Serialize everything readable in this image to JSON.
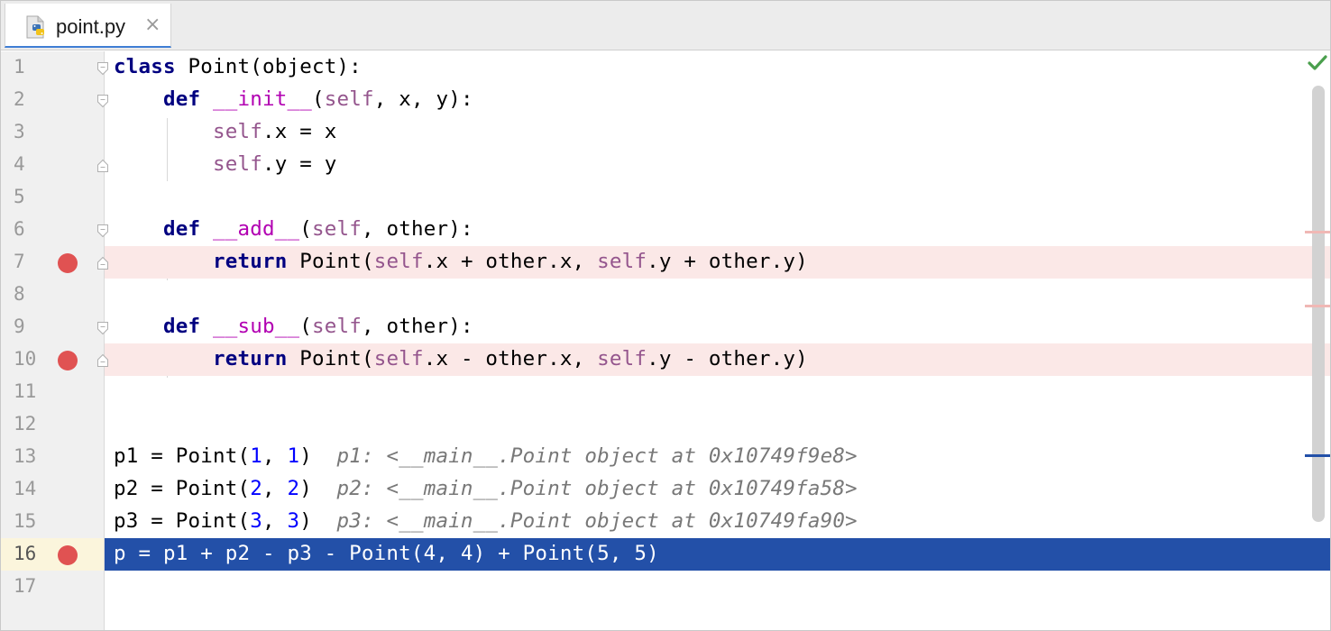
{
  "tab": {
    "filename": "point.py",
    "close": "×"
  },
  "colors": {
    "breakpoint": "#e05252",
    "breakpoint_line": "#fbe8e7",
    "execution_line": "#2350a8",
    "keyword": "#000080",
    "self": "#94558d",
    "dunder": "#b200b2",
    "number": "#0000ff",
    "inline_value": "#787878"
  },
  "status": {
    "inspection": "check-icon"
  },
  "lines": [
    {
      "n": "1",
      "breakpoint": false,
      "current": false,
      "fold": "open",
      "code": [
        {
          "t": "class",
          "c": "kw"
        },
        {
          "t": " Point(object):"
        }
      ]
    },
    {
      "n": "2",
      "breakpoint": false,
      "current": false,
      "fold": "open",
      "code": [
        {
          "t": "    "
        },
        {
          "t": "def",
          "c": "kw"
        },
        {
          "t": " "
        },
        {
          "t": "__init__",
          "c": "dunder"
        },
        {
          "t": "("
        },
        {
          "t": "self",
          "c": "self"
        },
        {
          "t": ", x, y):"
        }
      ]
    },
    {
      "n": "3",
      "breakpoint": false,
      "current": false,
      "fold": "",
      "code": [
        {
          "t": "        "
        },
        {
          "t": "self",
          "c": "self"
        },
        {
          "t": ".x = x"
        }
      ]
    },
    {
      "n": "4",
      "breakpoint": false,
      "current": false,
      "fold": "close",
      "code": [
        {
          "t": "        "
        },
        {
          "t": "self",
          "c": "self"
        },
        {
          "t": ".y = y"
        }
      ]
    },
    {
      "n": "5",
      "breakpoint": false,
      "current": false,
      "fold": "",
      "code": []
    },
    {
      "n": "6",
      "breakpoint": false,
      "current": false,
      "fold": "open",
      "code": [
        {
          "t": "    "
        },
        {
          "t": "def",
          "c": "kw"
        },
        {
          "t": " "
        },
        {
          "t": "__add__",
          "c": "dunder"
        },
        {
          "t": "("
        },
        {
          "t": "self",
          "c": "self"
        },
        {
          "t": ", other):"
        }
      ]
    },
    {
      "n": "7",
      "breakpoint": true,
      "current": false,
      "fold": "close",
      "code": [
        {
          "t": "        "
        },
        {
          "t": "return",
          "c": "kw"
        },
        {
          "t": " Point("
        },
        {
          "t": "self",
          "c": "self"
        },
        {
          "t": ".x + other.x, "
        },
        {
          "t": "self",
          "c": "self"
        },
        {
          "t": ".y + other.y)"
        }
      ]
    },
    {
      "n": "8",
      "breakpoint": false,
      "current": false,
      "fold": "",
      "code": []
    },
    {
      "n": "9",
      "breakpoint": false,
      "current": false,
      "fold": "open",
      "code": [
        {
          "t": "    "
        },
        {
          "t": "def",
          "c": "kw"
        },
        {
          "t": " "
        },
        {
          "t": "__sub__",
          "c": "dunder"
        },
        {
          "t": "("
        },
        {
          "t": "self",
          "c": "self"
        },
        {
          "t": ", other):"
        }
      ]
    },
    {
      "n": "10",
      "breakpoint": true,
      "current": false,
      "fold": "close",
      "code": [
        {
          "t": "        "
        },
        {
          "t": "return",
          "c": "kw"
        },
        {
          "t": " Point("
        },
        {
          "t": "self",
          "c": "self"
        },
        {
          "t": ".x - other.x, "
        },
        {
          "t": "self",
          "c": "self"
        },
        {
          "t": ".y - other.y)"
        }
      ]
    },
    {
      "n": "11",
      "breakpoint": false,
      "current": false,
      "fold": "",
      "code": []
    },
    {
      "n": "12",
      "breakpoint": false,
      "current": false,
      "fold": "",
      "code": []
    },
    {
      "n": "13",
      "breakpoint": false,
      "current": false,
      "fold": "",
      "code": [
        {
          "t": "p1 = Point("
        },
        {
          "t": "1",
          "c": "num"
        },
        {
          "t": ", "
        },
        {
          "t": "1",
          "c": "num"
        },
        {
          "t": ")  "
        },
        {
          "t": "p1: <__main__.Point object at 0x10749f9e8>",
          "c": "inline"
        }
      ]
    },
    {
      "n": "14",
      "breakpoint": false,
      "current": false,
      "fold": "",
      "code": [
        {
          "t": "p2 = Point("
        },
        {
          "t": "2",
          "c": "num"
        },
        {
          "t": ", "
        },
        {
          "t": "2",
          "c": "num"
        },
        {
          "t": ")  "
        },
        {
          "t": "p2: <__main__.Point object at 0x10749fa58>",
          "c": "inline"
        }
      ]
    },
    {
      "n": "15",
      "breakpoint": false,
      "current": false,
      "fold": "",
      "code": [
        {
          "t": "p3 = Point("
        },
        {
          "t": "3",
          "c": "num"
        },
        {
          "t": ", "
        },
        {
          "t": "3",
          "c": "num"
        },
        {
          "t": ")  "
        },
        {
          "t": "p3: <__main__.Point object at 0x10749fa90>",
          "c": "inline"
        }
      ]
    },
    {
      "n": "16",
      "breakpoint": true,
      "current": true,
      "fold": "",
      "code": [
        {
          "t": "p = p1 + p2 - p3 - Point("
        },
        {
          "t": "4",
          "c": "num"
        },
        {
          "t": ", "
        },
        {
          "t": "4",
          "c": "num"
        },
        {
          "t": ") + Point("
        },
        {
          "t": "5",
          "c": "num"
        },
        {
          "t": ", "
        },
        {
          "t": "5",
          "c": "num"
        },
        {
          "t": ")"
        }
      ]
    },
    {
      "n": "17",
      "breakpoint": false,
      "current": false,
      "fold": "",
      "code": []
    }
  ]
}
